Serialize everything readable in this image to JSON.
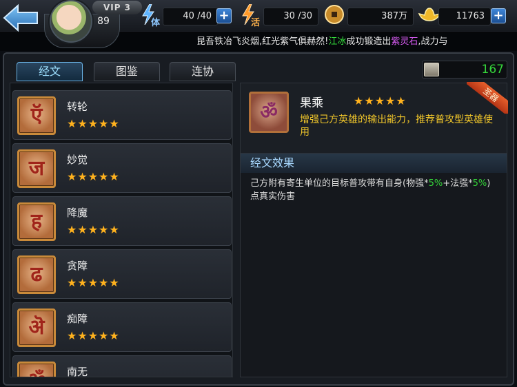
{
  "header": {
    "vip_label": "VIP 3",
    "level": "89",
    "stamina_label": "体",
    "stamina_value": "40 /40",
    "vitality_label": "活",
    "vitality_value": "30 /30",
    "coins_value": "387万",
    "gold_value": "11763",
    "plus_symbol": "+"
  },
  "marquee": {
    "part1": "昆吾铁冶飞炎烟,红光紫气俱赫然!",
    "player": "江冰",
    "part2": "成功锻造出",
    "item": "紫灵石",
    "part3": ",战力与"
  },
  "tabs": [
    {
      "label": "经文",
      "active": true
    },
    {
      "label": "图鉴",
      "active": false
    },
    {
      "label": "连协",
      "active": false
    }
  ],
  "score": "167",
  "scripture_list": [
    {
      "name": "转轮",
      "glyph": "ऍ",
      "stars": "★★★★★"
    },
    {
      "name": "妙觉",
      "glyph": "ज",
      "stars": "★★★★★"
    },
    {
      "name": "降魔",
      "glyph": "ह",
      "stars": "★★★★★"
    },
    {
      "name": "贪障",
      "glyph": "ढ",
      "stars": "★★★★★"
    },
    {
      "name": "痴障",
      "glyph": "ऄ",
      "stars": "★★★★★"
    },
    {
      "name": "南无",
      "glyph": "ॐ",
      "stars": "★★★★★"
    }
  ],
  "detail": {
    "name": "果乘",
    "stars": "★★★★★",
    "description": "增强己方英雄的输出能力，推荐普攻型英雄使用",
    "rank_tag": "圣器",
    "glyph": "ॐ",
    "effect_title": "经文效果",
    "effect_part1": "己方附有寄生单位的目标普攻带有自身(物强*",
    "effect_pct1": "5%",
    "effect_part2": "+法强*",
    "effect_pct2": "5%",
    "effect_part3": ")点真实伤害"
  },
  "colors": {
    "star": "#ffb21e",
    "highlight_green": "#35d63a",
    "highlight_purple": "#d55af0",
    "desc_yellow": "#f3c82a",
    "tab_active": "#9ee0ff"
  },
  "icons": {
    "back": "back-arrow-icon",
    "stamina": "lightning-icon",
    "vitality": "lightning-icon",
    "coins": "coin-icon",
    "gold": "gold-ingot-icon",
    "score": "scroll-icon"
  }
}
